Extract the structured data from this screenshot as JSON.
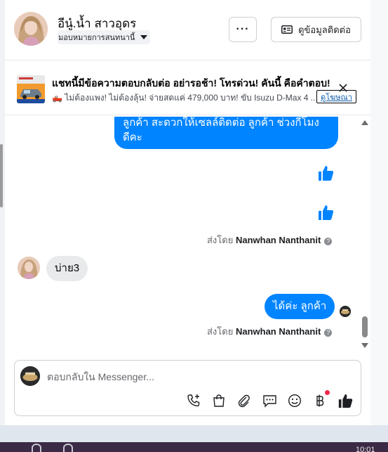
{
  "header": {
    "contact_name": "อีนู๋.น้ำ สาวอุดร",
    "assign_label": "มอบหมายการสนทนานี้",
    "more_label": "···",
    "contact_info_label": "ดูข้อมูลติดต่อ"
  },
  "ad": {
    "title": "แชทนี้มีข้อความตอบกลับต่อ อย่ารอช้า! โทรด่วน! คันนี้ คือคำตอบ!",
    "description": "🛻 ไม่ต้องแพง! ไม่ต้องลุ้น! จ่ายสดแค่ 479,000 บาท! ขับ Isuzu D-Max 4 ...",
    "link_label": "ดูโฆษณา"
  },
  "messages": {
    "top_bubble_line1": "ลูกค้า สะดวกให้เซลล์ติดต่อ ลูกค้า ช่วงกี่โมง",
    "top_bubble_line2": "ดีคะ",
    "sent_by_prefix": "ส่งโดย",
    "sender_name": "Nanwhan Nanthanit",
    "sent_by_prefix_2": "ส่งโดย",
    "sender_name_2": "Nanwhan Nanthanit",
    "incoming_text": "บ่าย3",
    "outgoing_text": "ได้ค่ะ ลูกค้า",
    "help_glyph": "?"
  },
  "composer": {
    "placeholder": "ตอบกลับใน Messenger..."
  },
  "taskbar": {
    "clock": "10:01"
  },
  "colors": {
    "accent": "#0084ff",
    "incoming_bubble": "#e9eaeb",
    "notification_dot": "#f02849"
  }
}
